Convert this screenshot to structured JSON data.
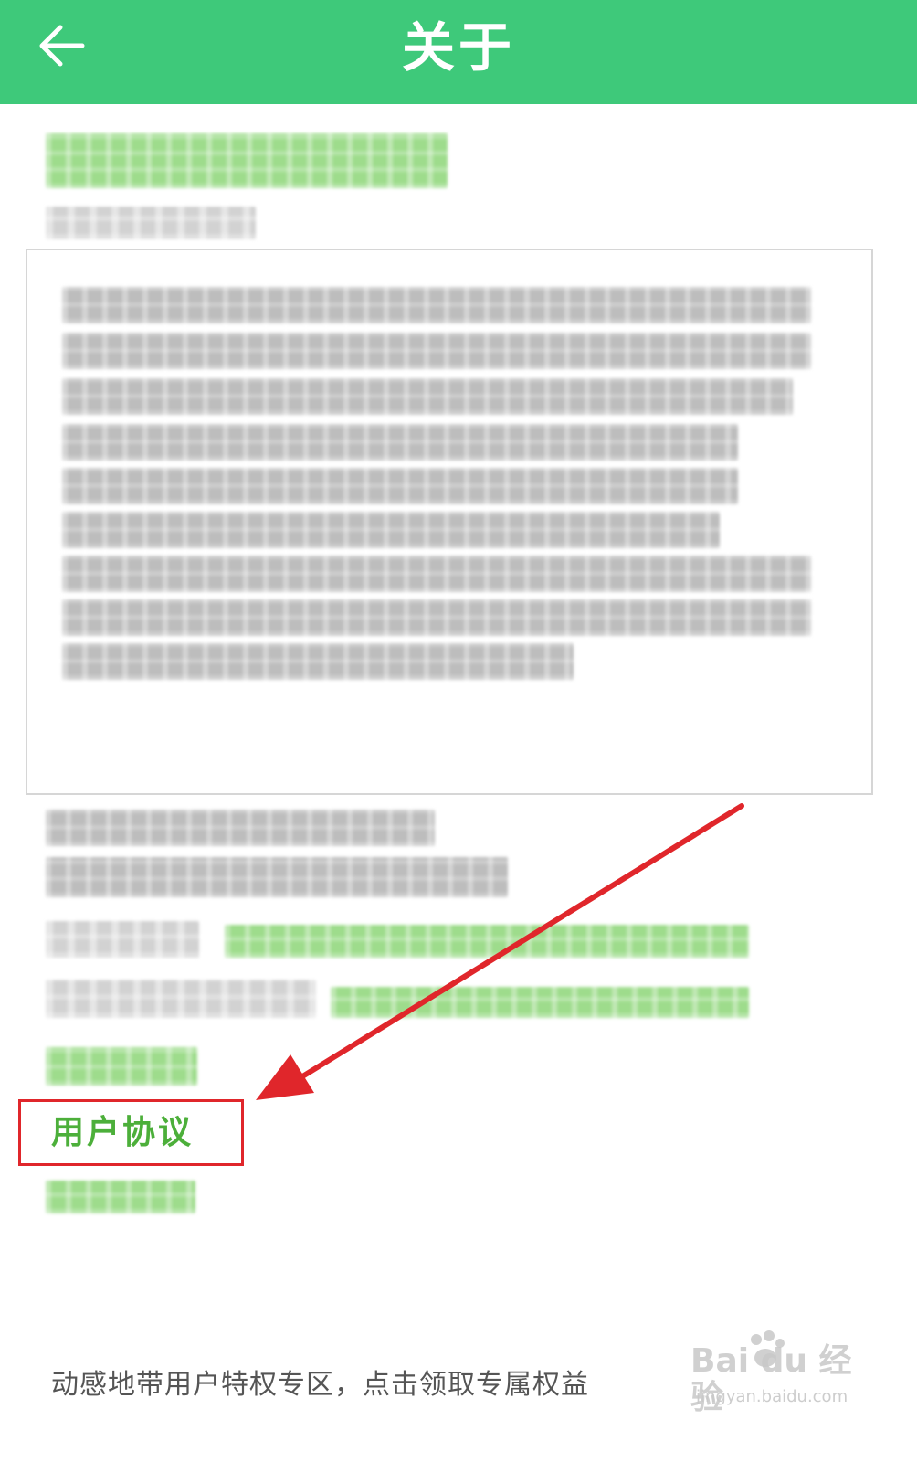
{
  "header": {
    "title": "关于",
    "background_color": "#3ec97a",
    "back_icon": "back-arrow-icon"
  },
  "links": {
    "user_agreement": "用户协议"
  },
  "footer": {
    "promo_text": "动感地带用户特权专区，点击领取专属权益"
  },
  "watermark": {
    "brand": "Bai du 经验",
    "sub": "jingyan.baidu.com"
  },
  "colors": {
    "link_green": "#4caf3a",
    "highlight_red": "#e0262b"
  }
}
